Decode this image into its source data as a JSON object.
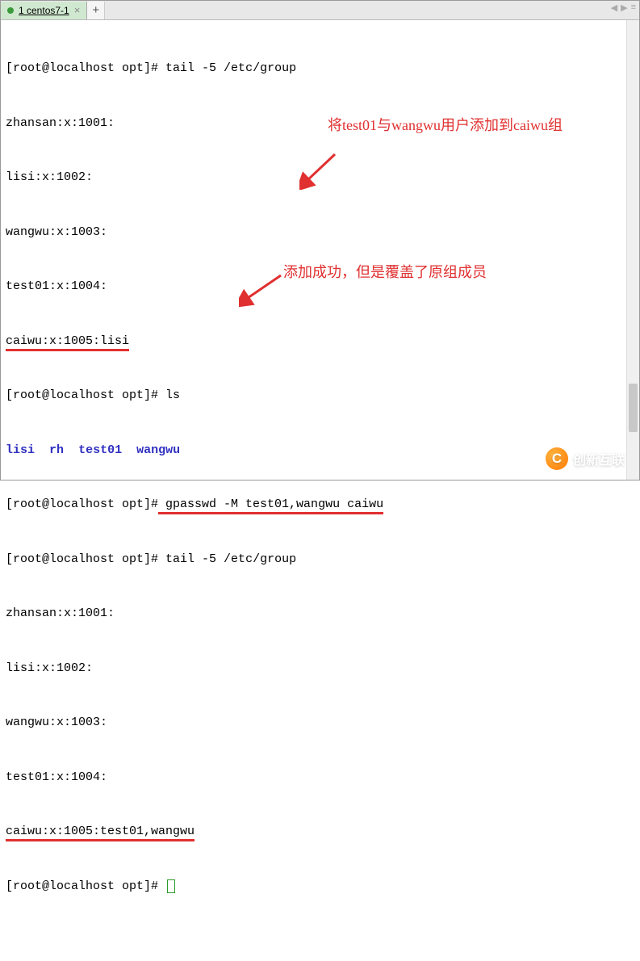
{
  "tab": {
    "title": "1 centos7-1",
    "close": "×",
    "add": "+"
  },
  "nav": {
    "left": "◀",
    "right": "▶",
    "menu": "≡"
  },
  "lines": {
    "l1_prompt": "[root@localhost opt]# ",
    "l1_cmd": "tail -5 /etc/group",
    "l2": "zhansan:x:1001:",
    "l3": "lisi:x:1002:",
    "l4": "wangwu:x:1003:",
    "l5": "test01:x:1004:",
    "l6": "caiwu:x:1005:lisi",
    "l7_prompt": "[root@localhost opt]# ",
    "l7_cmd": "ls",
    "l8_a": "lisi",
    "l8_b": "rh",
    "l8_c": "test01",
    "l8_d": "wangwu",
    "l9_prompt": "[root@localhost opt]#",
    "l9_cmd": " gpasswd -M test01,wangwu caiwu",
    "l10_prompt": "[root@localhost opt]# ",
    "l10_cmd": "tail -5 /etc/group",
    "l11": "zhansan:x:1001:",
    "l12": "lisi:x:1002:",
    "l13": "wangwu:x:1003:",
    "l14": "test01:x:1004:",
    "l15": "caiwu:x:1005:test01,wangwu",
    "l16_prompt": "[root@localhost opt]# "
  },
  "annotations": {
    "a1": "将test01与wangwu用户添加到caiwu组",
    "a2": "添加成功，但是覆盖了原组成员"
  },
  "watermark": {
    "text": "创新互联",
    "icon": "C"
  }
}
